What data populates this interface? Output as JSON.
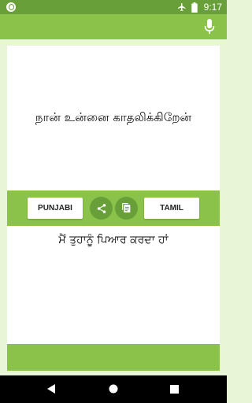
{
  "status_bar": {
    "time": "9:17",
    "icons": [
      "notification-dot-icon",
      "airplane-mode-icon",
      "battery-icon"
    ]
  },
  "toolbar": {
    "mic_icon": "microphone-icon"
  },
  "source": {
    "text": "நான் உன்னை காதலிக்கிறேன்"
  },
  "actions": {
    "source_language": "PUNJABI",
    "target_language": "TAMIL",
    "share_icon": "share-icon",
    "copy_icon": "copy-icon"
  },
  "target": {
    "text": "ਮੈਂ ਤੁਹਾਨੂੰ ਪਿਆਰ ਕਰਦਾ ਹਾਂ"
  },
  "nav": {
    "back_icon": "back-icon",
    "home_icon": "home-icon",
    "recent_icon": "recent-apps-icon"
  },
  "colors": {
    "status_bar": "#689f38",
    "primary": "#8bc34a",
    "background": "#e8f5d6",
    "round_button": "#689f38"
  }
}
